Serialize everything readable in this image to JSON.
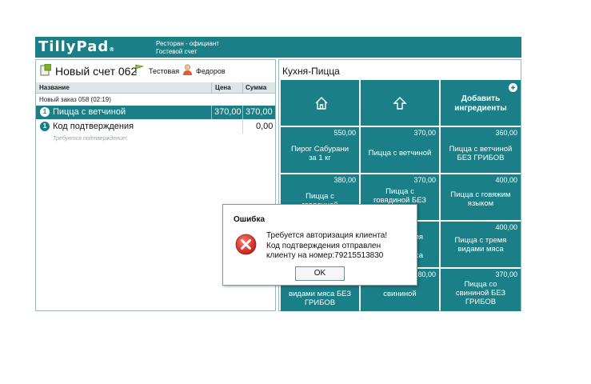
{
  "header": {
    "logo": "TillyPad",
    "logo_mark": "®",
    "role": "Ресторан - официант",
    "subtitle": "Гостевой счет"
  },
  "bill": {
    "title": "Новый счет 062",
    "table": "Тестовая",
    "waiter": "Федоров"
  },
  "columns": {
    "name": "Название",
    "price": "Цена",
    "sum": "Сумма"
  },
  "order": {
    "header": "Новый заказ 058 (02:19)",
    "items": [
      {
        "num": "1",
        "name": "Пицца с ветчиной",
        "price": "370,00",
        "sum": "370,00"
      },
      {
        "num": "1",
        "name": "Код подтверждения",
        "price": "",
        "sum": "0,00",
        "note": "Требуется подтверждение!"
      }
    ]
  },
  "menu": {
    "title": "Кухня-Пицца",
    "add_ingredients": [
      "Добавить",
      "ингредиенты"
    ],
    "tiles": [
      {
        "price": "550,00",
        "name": [
          "Пирог Сабурани",
          "за 1 кг"
        ]
      },
      {
        "price": "370,00",
        "name": [
          "Пицца с ветчиной"
        ]
      },
      {
        "price": "360,00",
        "name": [
          "Пицца с ветчиной",
          "БЕЗ ГРИБОВ"
        ]
      },
      {
        "price": "380,00",
        "name": [
          "Пицца с",
          "говядиной"
        ]
      },
      {
        "price": "370,00",
        "name": [
          "Пицца с",
          "говядиной БЕЗ"
        ]
      },
      {
        "price": "400,00",
        "name": [
          "Пицца с говяжим",
          "языком"
        ]
      },
      {
        "price": "",
        "name": [
          ""
        ]
      },
      {
        "price": "",
        "name": [
          "мя",
          "са"
        ]
      },
      {
        "price": "400,00",
        "name": [
          "Пицца с тремя",
          "видами мяса"
        ]
      },
      {
        "price": "",
        "name": [
          "видами мяса БЕЗ",
          "ГРИБОВ"
        ]
      },
      {
        "price": "380,00",
        "name": [
          "",
          "свининой"
        ]
      },
      {
        "price": "370,00",
        "name": [
          "Пицца со",
          "свининой БЕЗ",
          "ГРИБОВ"
        ]
      }
    ]
  },
  "dialog": {
    "title": "Ошибка",
    "message": [
      "Требуется авторизация клиента!",
      "Код подтверждения отправлен",
      "клиенту на номер:79215513830"
    ],
    "ok": "OK"
  },
  "colors": {
    "teal": "#1a7f86",
    "error_red": "#d9322a"
  }
}
